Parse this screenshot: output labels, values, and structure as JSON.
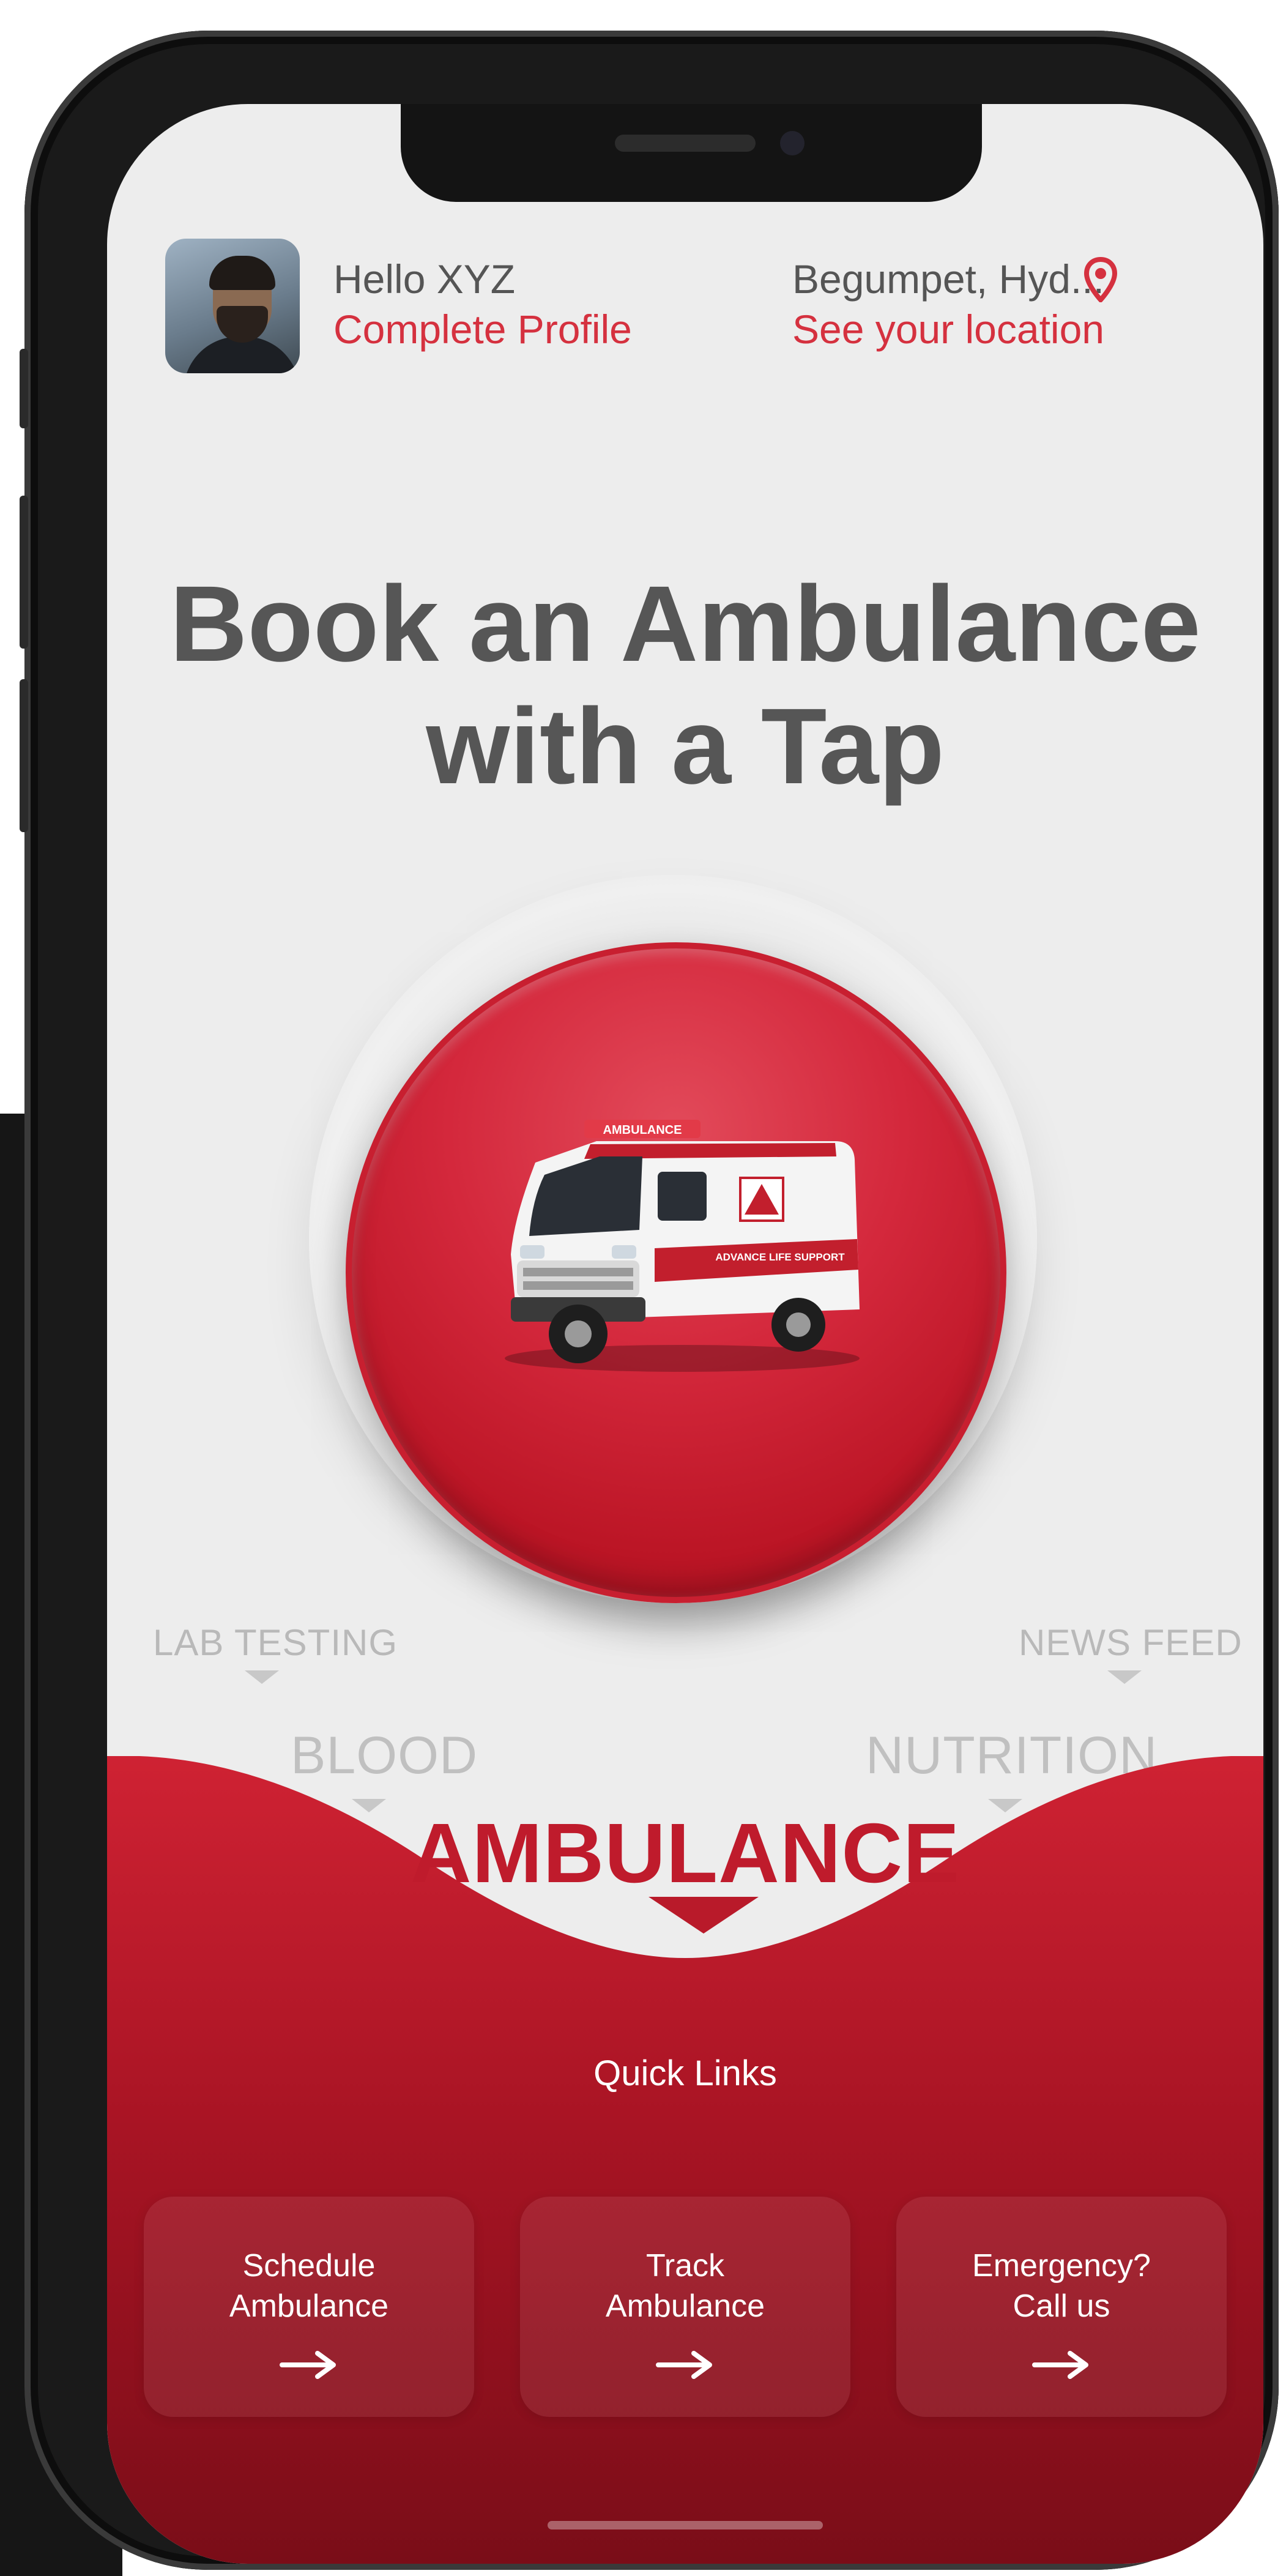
{
  "header": {
    "greeting": "Hello XYZ",
    "profile_link": "Complete Profile",
    "location": "Begumpet, Hyd...",
    "location_link": "See your location"
  },
  "headline": {
    "line1": "Book an Ambulance",
    "line2": "with a Tap"
  },
  "main_button": {
    "van_text_roof": "AMBULANCE",
    "van_text_side": "ADVANCE LIFE SUPPORT"
  },
  "service_nav": {
    "lab_testing": "LAB TESTING",
    "news_feed": "NEWS FEED",
    "blood": "BLOOD",
    "nutrition": "NUTRITION",
    "selected": "AMBULANCE"
  },
  "quick_links": {
    "title": "Quick Links",
    "items": [
      {
        "label": "Schedule\nAmbulance",
        "icon": "arrow-right-icon"
      },
      {
        "label": "Track\nAmbulance",
        "icon": "arrow-right-icon"
      },
      {
        "label": "Emergency?\nCall us",
        "icon": "arrow-right-icon"
      }
    ]
  },
  "colors": {
    "brand_red": "#d5313f",
    "dark_red": "#a30f1d",
    "heading_gray": "#565656",
    "background": "#ededed"
  }
}
